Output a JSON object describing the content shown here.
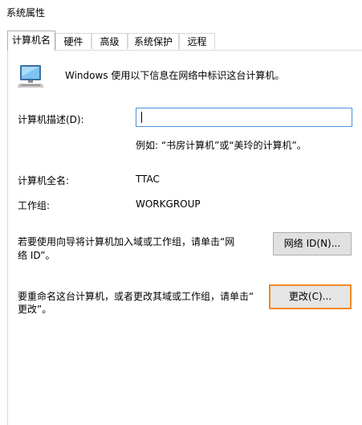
{
  "window": {
    "title": "系统属性"
  },
  "tabs": [
    {
      "label": "计算机名"
    },
    {
      "label": "硬件"
    },
    {
      "label": "高级"
    },
    {
      "label": "系统保护"
    },
    {
      "label": "远程"
    }
  ],
  "header": {
    "text": "Windows 使用以下信息在网络中标识这台计算机。",
    "icon": "computer-icon"
  },
  "description": {
    "label": "计算机描述(D):",
    "value": "",
    "example": "例如: “书房计算机”或“美玲的计算机”。"
  },
  "full_name": {
    "label": "计算机全名:",
    "value": "TTAC"
  },
  "workgroup": {
    "label": "工作组:",
    "value": "WORKGROUP"
  },
  "network_id": {
    "text_line1": "若要使用向导将计算机加入域或工作组，请单击“网",
    "text_line2": "络 ID”。",
    "button": "网络 ID(N)..."
  },
  "rename": {
    "text_line1": "要重命名这台计算机，或者更改其域或工作组，请单击“",
    "text_line2": "更改”。",
    "button": "更改(C)..."
  },
  "colors": {
    "focus_border": "#f08a24",
    "input_border": "#4a90d9",
    "button_bg": "#e1e1e1"
  }
}
